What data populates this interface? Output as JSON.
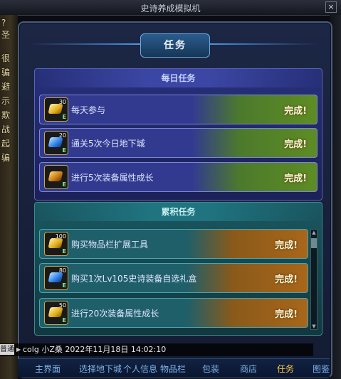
{
  "window": {
    "title": "史诗养成模拟机",
    "close_label": "×"
  },
  "left_strip_chars": [
    "?",
    "圣",
    "很",
    "骗",
    "避",
    "示",
    "欺",
    "战",
    "起",
    "骗"
  ],
  "panel": {
    "title": "任务"
  },
  "daily": {
    "header": "每日任务",
    "tasks": [
      {
        "label": "每天参与",
        "reward": "30",
        "icon": "gold-gem-icon",
        "status": "完成!"
      },
      {
        "label": "通关5次今日地下城",
        "reward": "20",
        "icon": "blue-gem-icon",
        "status": "完成!"
      },
      {
        "label": "进行5次装备属性成长",
        "reward": "",
        "icon": "gold-fist-icon",
        "status": "完成!"
      }
    ]
  },
  "cumulative": {
    "header": "累积任务",
    "tasks": [
      {
        "label": "购买物品栏扩展工具",
        "reward": "100",
        "icon": "gold-gem-icon",
        "status": "完成!"
      },
      {
        "label": "购买1次Lv105史诗装备自选礼盒",
        "reward": "80",
        "icon": "blue-gem-icon",
        "status": "完成!"
      },
      {
        "label": "进行20次装备属性成长",
        "reward": "50",
        "icon": "gold-gem-icon",
        "status": "完成!"
      }
    ]
  },
  "chat": {
    "channel": "普通",
    "message": "colg 小Z桑 2022年11月18日 14:02:10"
  },
  "nav": {
    "items": [
      "主界面",
      "选择地下城",
      "个人信息",
      "物品栏",
      "包装",
      "商店",
      "任务",
      "图鉴"
    ],
    "active": "任务"
  },
  "colors": {
    "accent": "#ffc64a",
    "nav_text": "#7fb4ee",
    "daily_bg": "#323a90",
    "cumulative_bg": "#1f5f6a"
  }
}
